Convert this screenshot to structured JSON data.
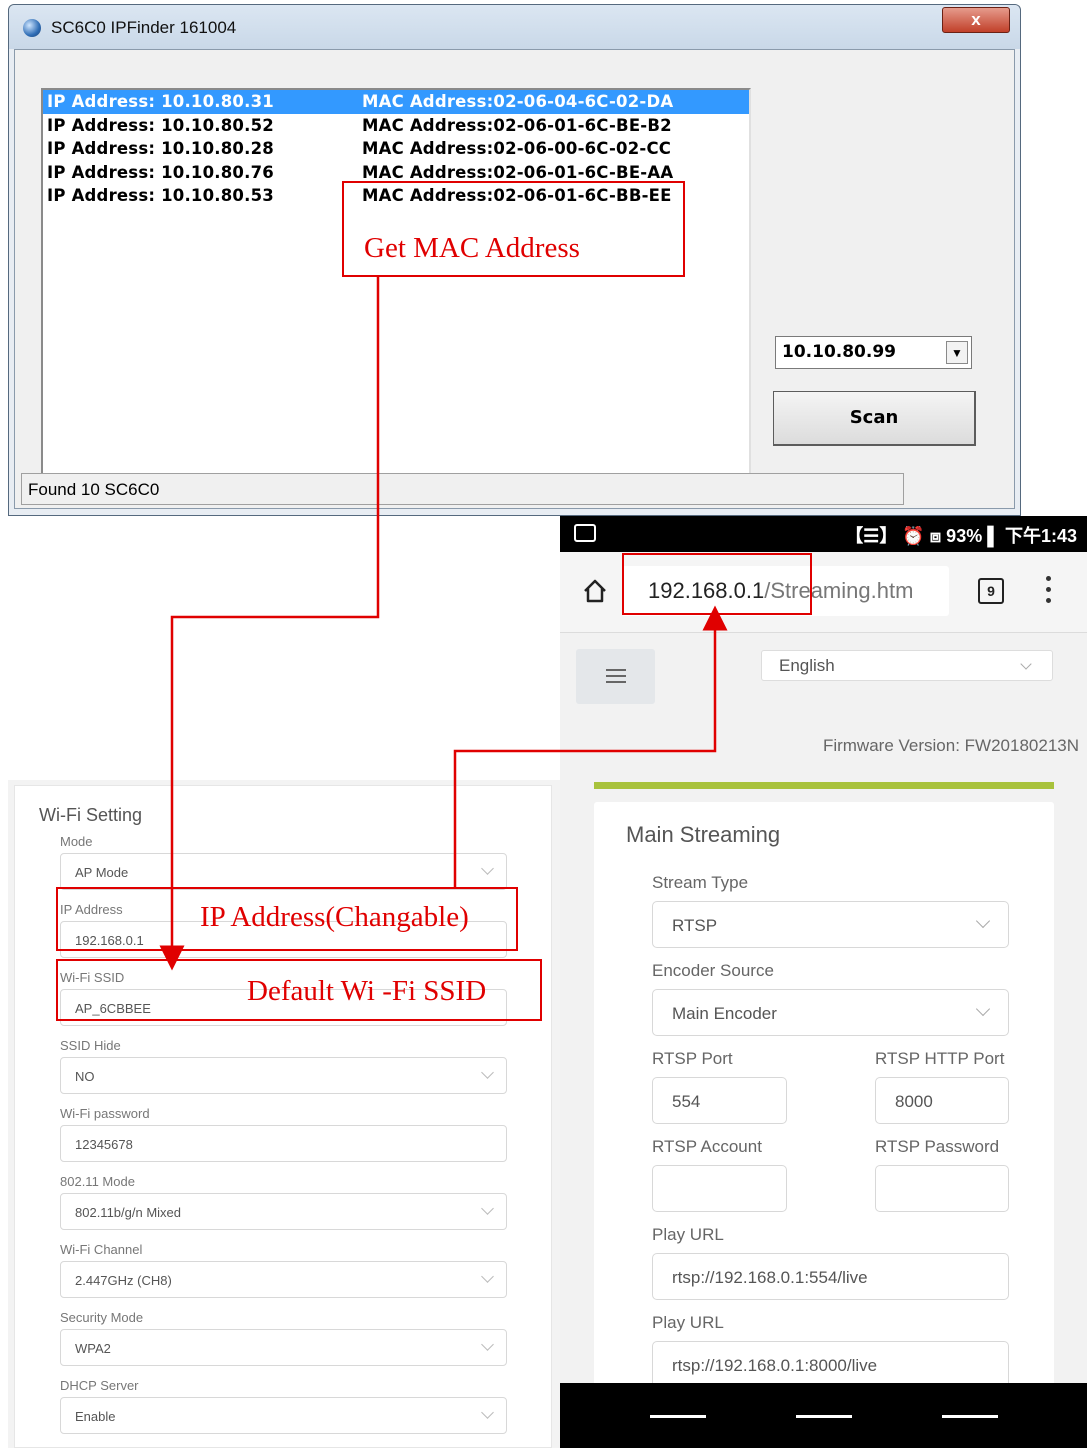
{
  "ipfinder": {
    "title": "SC6C0 IPFinder 161004",
    "close_label": "x",
    "devices": [
      {
        "ip": "IP Address: 10.10.80.31",
        "mac": "MAC Address:02-06-04-6C-02-DA",
        "selected": true
      },
      {
        "ip": "IP Address: 10.10.80.52",
        "mac": "MAC Address:02-06-01-6C-BE-B2",
        "selected": false
      },
      {
        "ip": "IP Address: 10.10.80.28",
        "mac": "MAC Address:02-06-00-6C-02-CC",
        "selected": false
      },
      {
        "ip": "IP Address: 10.10.80.76",
        "mac": "MAC Address:02-06-01-6C-BE-AA",
        "selected": false
      },
      {
        "ip": "IP Address: 10.10.80.53",
        "mac": "MAC Address:02-06-01-6C-BB-EE",
        "selected": false
      }
    ],
    "ip_select_value": "10.10.80.99",
    "scan_label": "Scan",
    "status_text": "Found 10 SC6C0",
    "selection_color": "#3399ff"
  },
  "wifi_setting": {
    "title": "Wi-Fi Setting",
    "fields": [
      {
        "label": "Mode",
        "value": "AP Mode",
        "type": "select"
      },
      {
        "label": "IP Address",
        "value": "192.168.0.1",
        "type": "input"
      },
      {
        "label": "Wi-Fi SSID",
        "value": "AP_6CBBEE",
        "type": "input"
      },
      {
        "label": "SSID Hide",
        "value": "NO",
        "type": "select"
      },
      {
        "label": "Wi-Fi password",
        "value": "12345678",
        "type": "input"
      },
      {
        "label": "802.11 Mode",
        "value": "802.11b/g/n Mixed",
        "type": "select"
      },
      {
        "label": "Wi-Fi Channel",
        "value": "2.447GHz (CH8)",
        "type": "select"
      },
      {
        "label": "Security Mode",
        "value": "WPA2",
        "type": "select"
      },
      {
        "label": "DHCP Server",
        "value": "Enable",
        "type": "select"
      }
    ]
  },
  "phone": {
    "status_right": "【☰】 ⏰ ⧈ 93% ▌ 下午1:43",
    "status_icons": "vibrate-icon, alarm-icon, signal-icon, battery-icon",
    "url_host": "192.168.0.1",
    "url_path": "/Streaming.htm",
    "tab_count": "9",
    "language": "English",
    "firmware": "Firmware Version: FW20180213N",
    "accent_color": "#a8c23c",
    "stream": {
      "title": "Main Streaming",
      "stream_type_label": "Stream Type",
      "stream_type_value": "RTSP",
      "encoder_label": "Encoder Source",
      "encoder_value": "Main Encoder",
      "rtsp_port_label": "RTSP Port",
      "rtsp_port_value": "554",
      "rtsp_http_port_label": "RTSP HTTP Port",
      "rtsp_http_port_value": "8000",
      "rtsp_account_label": "RTSP Account",
      "rtsp_account_value": "",
      "rtsp_password_label": "RTSP Password",
      "rtsp_password_value": "",
      "play_url_label_1": "Play URL",
      "play_url_value_1": "rtsp://192.168.0.1:554/live",
      "play_url_label_2": "Play URL",
      "play_url_value_2": "rtsp://192.168.0.1:8000/live"
    }
  },
  "annotations": {
    "mac": "Get MAC Address",
    "ip": "IP Address(Changable)",
    "ssid": "Default Wi -Fi SSID",
    "color": "#e00000"
  }
}
